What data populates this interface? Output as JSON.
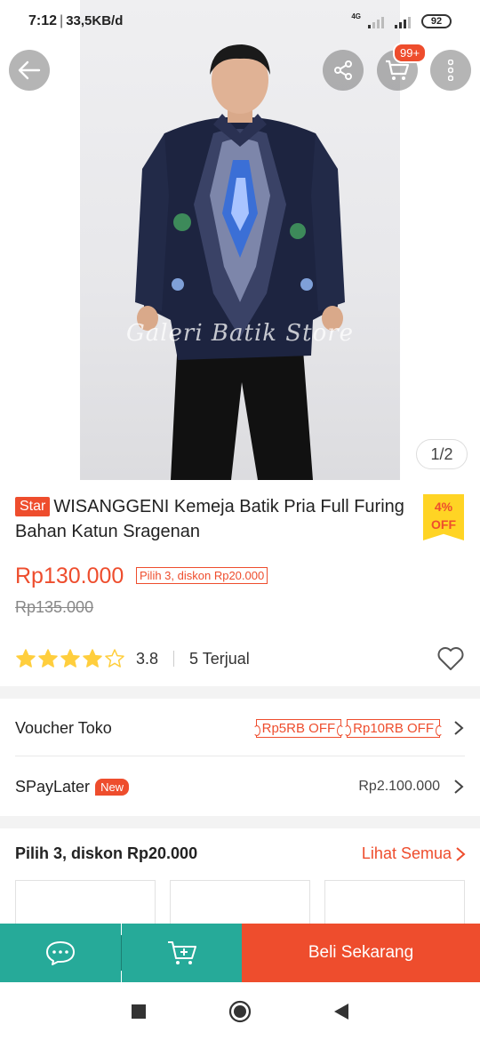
{
  "status_bar": {
    "time": "7:12",
    "separator": "|",
    "speed": "33,5KB/d",
    "network": "4G",
    "battery": "92"
  },
  "top_actions": {
    "cart_badge": "99+"
  },
  "hero": {
    "watermark": "Galeri Batik Store",
    "counter": "1/2"
  },
  "product": {
    "badge": "Star",
    "title": "WISANGGENI Kemeja Batik Pria Full Furing Bahan Katun Sragenan",
    "discount_pct": "4%",
    "discount_label": "OFF",
    "price": "Rp130.000",
    "promo": "Pilih 3, diskon Rp20.000",
    "original_price": "Rp135.000",
    "rating_value": 3.8,
    "rating_text": "3.8",
    "sold": "5 Terjual"
  },
  "voucher_row": {
    "label": "Voucher Toko",
    "vouchers": [
      "Rp5RB OFF",
      "Rp10RB OFF"
    ]
  },
  "paylater_row": {
    "label": "SPayLater",
    "tag": "New",
    "amount": "Rp2.100.000"
  },
  "bundle": {
    "title": "Pilih 3, diskon Rp20.000",
    "see_all": "Lihat Semua"
  },
  "bottom_bar": {
    "buy_now": "Beli Sekarang"
  },
  "colors": {
    "brand": "#ee4d2d",
    "teal": "#26aa99",
    "star": "#ffce3d",
    "off_tag": "#ffd424"
  }
}
